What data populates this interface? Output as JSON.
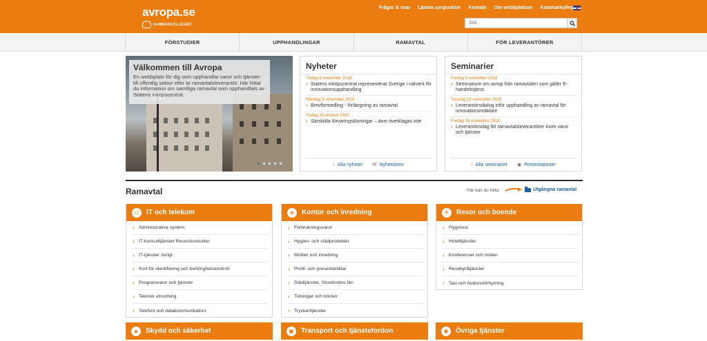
{
  "header": {
    "logo": "avropa.se",
    "logo_sub": "KAMMARKOLLEGIET",
    "links": [
      "Frågor & svar",
      "Lämna synpunkter",
      "Kontakt",
      "Om webbplatsen",
      "Kammarkollegiet"
    ],
    "search_placeholder": "Sök"
  },
  "nav": [
    "FÖRSTUDIER",
    "UPPHANDLINGAR",
    "RAMAVTAL",
    "FÖR LEVERANTÖRER"
  ],
  "hero": {
    "title": "Välkommen till Avropa",
    "text": "En webbplats för dig som upphandlar varor och tjänster till offentlig sektor eller är ramavtalsleverantör. Här hittar du information om samtliga ramavtal som upphandlats av Statens inköpscentral."
  },
  "news": {
    "title": "Nyheter",
    "items": [
      {
        "date": "Tisdag 6 november 2018",
        "title": "Statens inköpscentral representerar Sverige i nätverk för innovationsupphandling"
      },
      {
        "date": "Måndag 5 november 2018",
        "title": "Brevförmedling - förlängning av ramavtal"
      },
      {
        "date": "Tisdag 30 oktober 2018",
        "title": "Särskilda förvaringslösningar – dom överklagas inte"
      }
    ],
    "footer": [
      "Alla nyheter",
      "Nyhetsbrev"
    ]
  },
  "seminars": {
    "title": "Seminarier",
    "items": [
      {
        "date": "Fredag 9 november 2018",
        "title": "Seminarium om avrop från ramavtalen som gäller E-handelstjänst"
      },
      {
        "date": "Torsdag 15 november 2018",
        "title": "Leverantörsdialog inför upphandling av ramavtal för innovationsmäklare"
      },
      {
        "date": "Fredag 16 november 2018",
        "title": "Leverantörsdag för ramavtalsleverantörer inom varor och tjänster"
      }
    ],
    "footer": [
      "Alla seminarier",
      "Presentationer"
    ]
  },
  "ramavtal": {
    "title": "Ramavtal",
    "find_text": "Här kan du hitta:",
    "expired_link": "Utgångna ramavtal"
  },
  "categories": [
    {
      "title": "IT och telekom",
      "icon": "monitor-icon",
      "items": [
        "Administrativa system",
        "IT-konsulttjänster Resurskonsulter",
        "IT-tjänster övrigt",
        "Kort för identifiering och behörighetskontroll",
        "Programvaror och tjänster",
        "Teknisk utrustning",
        "Telefoni och datakommunikation"
      ]
    },
    {
      "title": "Kontor och inredning",
      "icon": "chair-icon",
      "items": [
        "Förbrukningsvaror",
        "Hygien- och städprodukter",
        "Möbler och inredning",
        "Profil- och presentartiklar",
        "Städtjänster, Stockholms län",
        "Tidningar och böcker",
        "Tryckeritjänster"
      ]
    },
    {
      "title": "Resor och boende",
      "icon": "plane-icon",
      "items": [
        "Flygresor",
        "Hotelltjänster",
        "Konferenser och möten",
        "Resebyråtjänster",
        "Taxi och fordonsförhyrning"
      ]
    },
    {
      "title": "Skydd och säkerhet",
      "icon": "lock-icon",
      "items": []
    },
    {
      "title": "Transport och tjänstefordon",
      "icon": "truck-icon",
      "items": []
    },
    {
      "title": "Övriga tjänster",
      "icon": "eye-icon",
      "items": []
    }
  ]
}
